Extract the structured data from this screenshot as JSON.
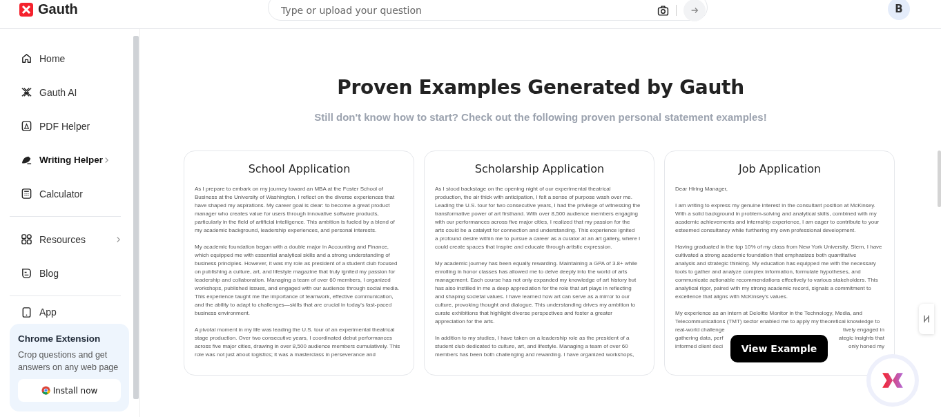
{
  "brand": "Gauth",
  "search": {
    "placeholder": "Type or upload your question"
  },
  "avatar": "B",
  "sidebar": {
    "groups": [
      [
        {
          "label": "Home",
          "selected": false,
          "expandable": false
        },
        {
          "label": "Gauth AI",
          "selected": false,
          "expandable": false
        },
        {
          "label": "PDF Helper",
          "selected": false,
          "expandable": false
        },
        {
          "label": "Writing Helper",
          "selected": true,
          "expandable": true
        },
        {
          "label": "Calculator",
          "selected": false,
          "expandable": false
        }
      ],
      [
        {
          "label": "Resources",
          "selected": false,
          "expandable": true
        },
        {
          "label": "Blog",
          "selected": false,
          "expandable": false
        }
      ],
      [
        {
          "label": "App",
          "selected": false,
          "expandable": false
        }
      ]
    ],
    "promo": {
      "title": "Chrome Extension",
      "text": "Crop questions and get answers on any web page",
      "button": "Install now"
    }
  },
  "section": {
    "title": "Proven Examples Generated by Gauth",
    "subtitle": "Still don't know how to start? Check out the following proven personal statement examples!",
    "view_button": "View Example",
    "cards": [
      {
        "title": "School Application",
        "hovered": false,
        "paragraphs": [
          [
            "As I prepare to embark on my journey toward an MBA at the Foster School of",
            "Business at the University of Washington, I reflect on the diverse experiences that",
            "have shaped my aspirations. My career goal is clear: to become a great product",
            "manager who creates value for users through innovative software products,",
            "particularly in the field of artificial intelligence. This ambition is fueled by a blend of",
            "my academic background, leadership experiences, and personal interests."
          ],
          [
            "My academic foundation began with a double major in Accounting and Finance,",
            "which equipped me with essential analytical skills and a strong understanding of",
            "business principles. However, it was my role as president of a student club focused",
            "on publishing a culture, art, and lifestyle magazine that truly ignited my passion for",
            "leadership and collaboration. Managing a team of over 60 members, I organized",
            "workshops, published issues, and engaged with our audience through social media.",
            "This experience taught me the importance of teamwork, effective communication,",
            "and the ability to adapt to challenges—skills that are crucial in today's fast-paced",
            "business environment."
          ],
          [
            "A pivotal moment in my life was leading the U.S. tour of an experimental theatrical",
            "stage production. Over two consecutive years, I coordinated debut performances",
            "across five major cities, drawing in over 8,500 audience members cumulatively. This",
            "role was not just about logistics; it was a masterclass in perseverance and"
          ]
        ]
      },
      {
        "title": "Scholarship Application",
        "hovered": false,
        "paragraphs": [
          [
            "As I stood backstage on the opening night of our experimental theatrical",
            "production, the air thick with anticipation, I felt a sense of purpose wash over me.",
            "Leading the U.S. tour for two consecutive years, I had the privilege of witnessing the",
            "transformative power of art firsthand. With over 8,500 audience members engaging",
            "with our performances across five major cities, I realized that my passion for the",
            "arts could be a catalyst for connection and understanding. This experience ignited",
            "a profound desire within me to pursue a career as a curator at an art gallery, where I",
            "could create spaces that inspire and educate through artistic expression."
          ],
          [
            "My academic journey has been equally rewarding. Maintaining a GPA of 3.8+ while",
            "enrolling in honor classes has allowed me to delve deeply into the world of arts",
            "management. Each course has not only expanded my knowledge of art history but",
            "has also instilled in me a deep appreciation for the role that art plays in reflecting",
            "and shaping societal values. I have learned how art can serve as a mirror to our",
            "culture, provoking thought and dialogue. This understanding drives my ambition to",
            "curate exhibitions that highlight diverse perspectives and foster a greater",
            "appreciation for the arts."
          ],
          [
            "In addition to my studies, I have taken on a leadership role as the president of a",
            "student club dedicated to culture, art, and lifestyle. Managing a team of over 60",
            "members has been both challenging and rewarding. I have organized workshops,"
          ]
        ]
      },
      {
        "title": "Job Application",
        "hovered": true,
        "paragraphs": [
          [
            "Dear Hiring Manager,"
          ],
          [
            "I am writing to express my genuine interest in the consultant position at McKinsey.",
            "With a solid background in problem-solving and analytical skills, combined with my",
            "academic achievements and internship experience, I am eager to contribute to your",
            "esteemed consultancy while furthering my own professional development."
          ],
          [
            "Having graduated in the top 10% of my class from New York University, Stern, I have",
            "cultivated a strong academic foundation that emphasizes both quantitative",
            "analysis and strategic thinking. My education has equipped me with the necessary",
            "tools to gather and analyze complex information, formulate hypotheses, and",
            "communicate actionable recommendations effectively to various stakeholders. This",
            "analytical rigor, paired with my strong academic record, signals a commitment to",
            "excellence that aligns with McKinsey's values."
          ],
          [
            "My experience as an intern at Deloitte Monitor in the Technology, Media, and",
            "Telecommunications (TMT) sector enabled me to apply my theoretical knowledge to",
            {
              "head": "real-world challenge",
              "tail": "tively engaged in"
            },
            {
              "head": "gathering data, perf",
              "tail": "ategic insights that"
            },
            {
              "head": "informed client deci",
              "tail": "only honed my"
            }
          ]
        ]
      }
    ]
  }
}
